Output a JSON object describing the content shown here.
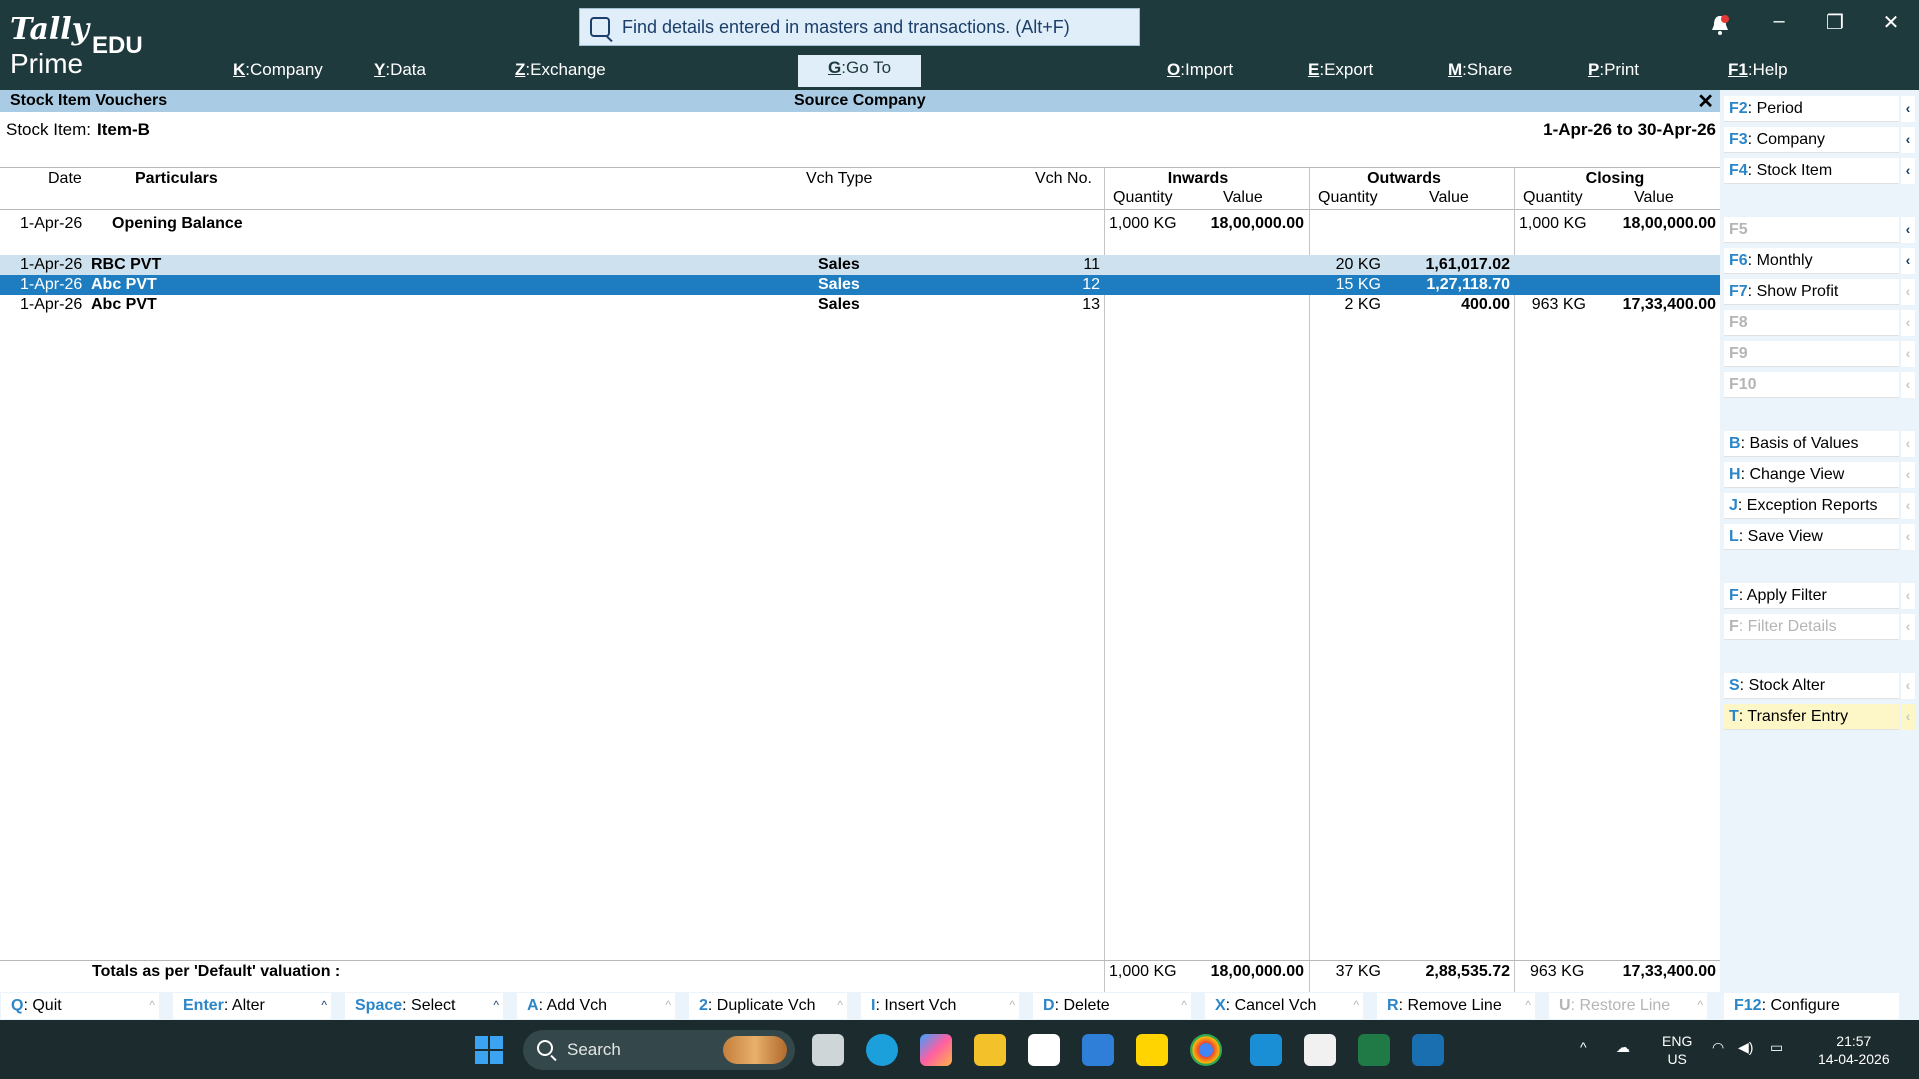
{
  "app": {
    "brand_top": "Tally",
    "brand_bottom": "Prime",
    "edition": "EDU"
  },
  "search": {
    "placeholder": "Find details entered in masters and transactions. (Alt+F)"
  },
  "menu": [
    {
      "key": "K",
      "label": "Company"
    },
    {
      "key": "Y",
      "label": "Data"
    },
    {
      "key": "Z",
      "label": "Exchange"
    },
    {
      "key": "G",
      "label": "Go To"
    },
    {
      "key": "O",
      "label": "Import"
    },
    {
      "key": "E",
      "label": "Export"
    },
    {
      "key": "M",
      "label": "Share"
    },
    {
      "key": "P",
      "label": "Print"
    },
    {
      "key": "F1",
      "label": "Help"
    }
  ],
  "window": {
    "minimize": "–",
    "restore": "❐",
    "close": "✕"
  },
  "report": {
    "title": "Stock Item Vouchers",
    "company": "Source Company",
    "close": "✕",
    "stock_item_label": "Stock Item:",
    "stock_item_value": "Item-B",
    "period": "1-Apr-26 to 30-Apr-26"
  },
  "columns": {
    "date": "Date",
    "particulars": "Particulars",
    "vch_type": "Vch Type",
    "vch_no": "Vch No.",
    "inwards": "Inwards",
    "outwards": "Outwards",
    "closing": "Closing",
    "quantity": "Quantity",
    "value": "Value"
  },
  "opening": {
    "date": "1-Apr-26",
    "particulars": "Opening Balance",
    "in_qty": "1,000 KG",
    "in_val": "18,00,000.00",
    "cl_qty": "1,000 KG",
    "cl_val": "18,00,000.00"
  },
  "rows": [
    {
      "date": "1-Apr-26",
      "particulars": "RBC PVT",
      "vch_type": "Sales",
      "vch_no": "11",
      "out_qty": "20 KG",
      "out_val": "1,61,017.02",
      "cl_qty": "",
      "cl_val": ""
    },
    {
      "date": "1-Apr-26",
      "particulars": "Abc PVT",
      "vch_type": "Sales",
      "vch_no": "12",
      "out_qty": "15 KG",
      "out_val": "1,27,118.70",
      "cl_qty": "",
      "cl_val": ""
    },
    {
      "date": "1-Apr-26",
      "particulars": "Abc PVT",
      "vch_type": "Sales",
      "vch_no": "13",
      "out_qty": "2 KG",
      "out_val": "400.00",
      "cl_qty": "963 KG",
      "cl_val": "17,33,400.00"
    }
  ],
  "totals": {
    "label": "Totals as per 'Default' valuation :",
    "in_qty": "1,000 KG",
    "in_val": "18,00,000.00",
    "out_qty": "37 KG",
    "out_val": "2,88,535.72",
    "cl_qty": "963 KG",
    "cl_val": "17,33,400.00"
  },
  "right_buttons": [
    {
      "key": "F2",
      "label": "Period"
    },
    {
      "key": "F3",
      "label": "Company"
    },
    {
      "key": "F4",
      "label": "Stock Item"
    },
    {
      "key": "F5",
      "label": ""
    },
    {
      "key": "F6",
      "label": "Monthly"
    },
    {
      "key": "F7",
      "label": "Show Profit"
    },
    {
      "key": "F8",
      "label": ""
    },
    {
      "key": "F9",
      "label": ""
    },
    {
      "key": "F10",
      "label": ""
    },
    {
      "key": "B",
      "label": "Basis of Values"
    },
    {
      "key": "H",
      "label": "Change View"
    },
    {
      "key": "J",
      "label": "Exception Reports"
    },
    {
      "key": "L",
      "label": "Save View"
    },
    {
      "key": "F",
      "label": "Apply Filter"
    },
    {
      "key": "F",
      "label": "Filter Details"
    },
    {
      "key": "S",
      "label": "Stock Alter"
    },
    {
      "key": "T",
      "label": "Transfer Entry"
    },
    {
      "key": "F12",
      "label": "Configure"
    }
  ],
  "bottom_buttons": [
    {
      "key": "Q",
      "label": "Quit"
    },
    {
      "key": "Enter",
      "label": "Alter"
    },
    {
      "key": "Space",
      "label": "Select"
    },
    {
      "key": "A",
      "label": "Add Vch"
    },
    {
      "key": "2",
      "label": "Duplicate Vch"
    },
    {
      "key": "I",
      "label": "Insert Vch"
    },
    {
      "key": "D",
      "label": "Delete"
    },
    {
      "key": "X",
      "label": "Cancel Vch"
    },
    {
      "key": "R",
      "label": "Remove Line"
    },
    {
      "key": "U",
      "label": "Restore Line"
    }
  ],
  "taskbar": {
    "search": "Search",
    "lang_top": "ENG",
    "lang_bottom": "US",
    "time": "21:57",
    "date": "14-04-2026"
  },
  "colors": {
    "accent": "#1e7cc0",
    "header_bg": "#1f3a3d",
    "title_bg": "#a9cce4",
    "key_blue": "#2b86c9"
  }
}
